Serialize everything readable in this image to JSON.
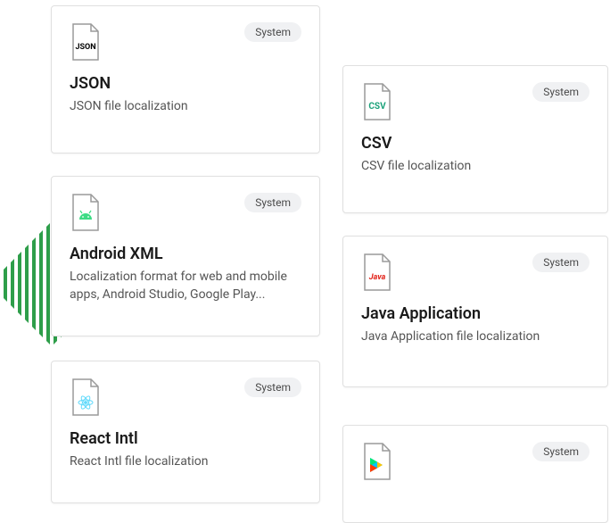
{
  "badge_label": "System",
  "cards": {
    "json": {
      "title": "JSON",
      "desc": "JSON file localization",
      "icon_label": "JSON",
      "icon_color": "#000000"
    },
    "android": {
      "title": "Android XML",
      "desc": "Localization format for web and mobile apps, Android Studio, Google Play...",
      "icon_shape": "android",
      "icon_color": "#3ddc84"
    },
    "react": {
      "title": "React Intl",
      "desc": "React Intl file localization",
      "icon_shape": "react",
      "icon_color": "#61dafb"
    },
    "csv": {
      "title": "CSV",
      "desc": "CSV file localization",
      "icon_label": "CSV",
      "icon_color": "#1aa179"
    },
    "java": {
      "title": "Java Application",
      "desc": "Java Application file localization",
      "icon_label": "Java",
      "icon_color": "#e2231a"
    },
    "play": {
      "title": "",
      "desc": "",
      "icon_shape": "play",
      "icon_color": "#00a8ff"
    }
  }
}
